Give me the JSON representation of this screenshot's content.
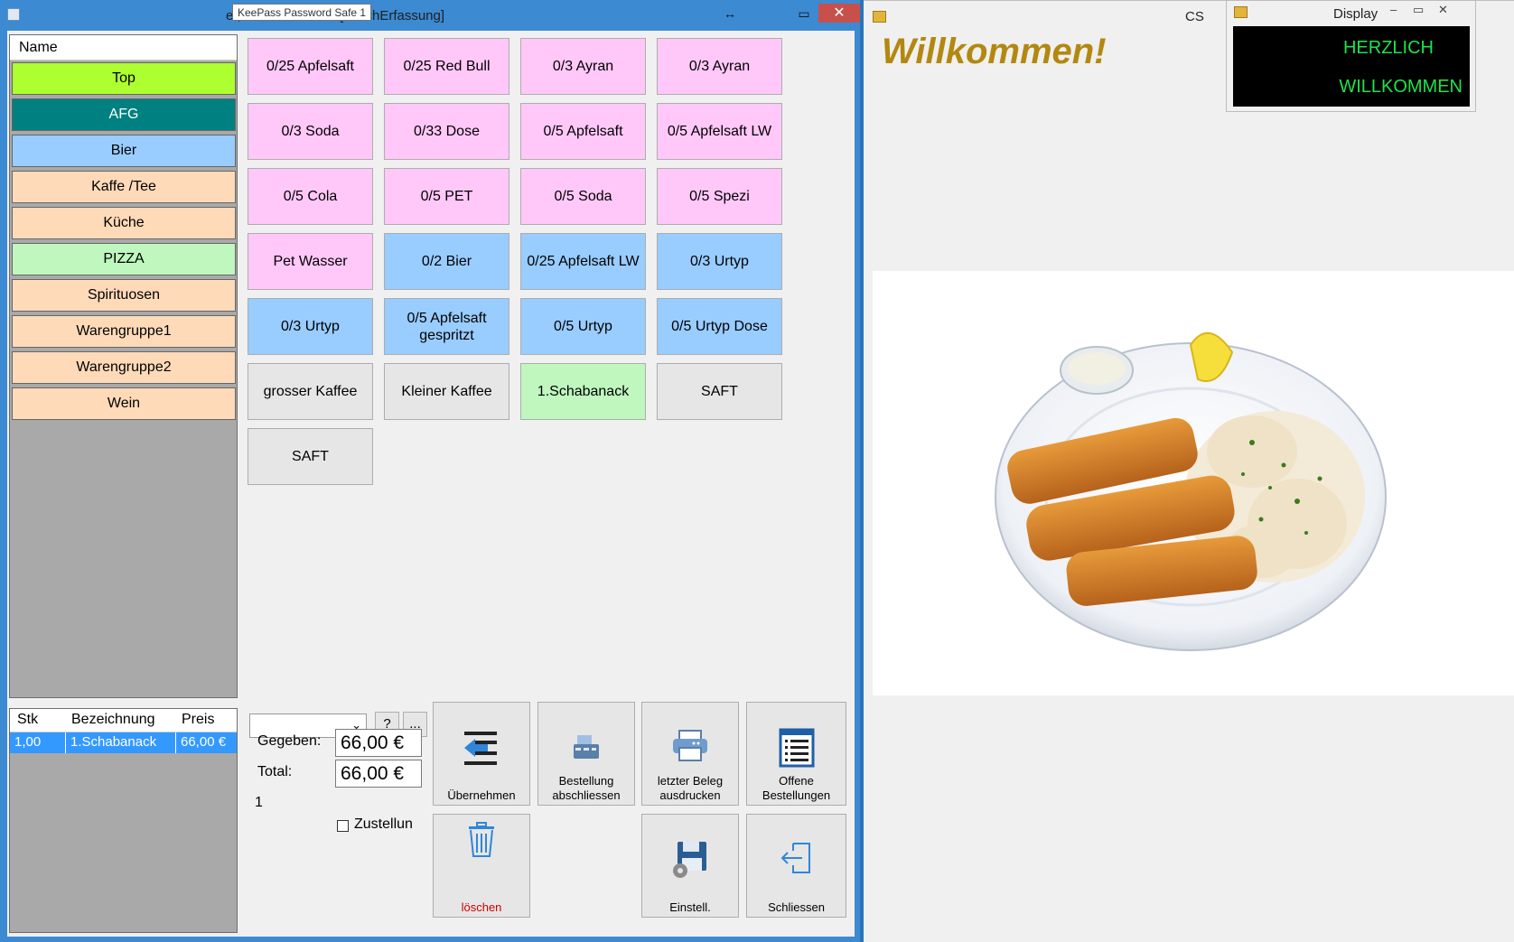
{
  "main_window": {
    "title": "et, GRITON.NET - [TouchErfassung]",
    "tooltip": "KeePass Password Safe 1",
    "close_glyph": "✕",
    "restore_glyph": "↔",
    "maximize_glyph": "▭"
  },
  "categories": {
    "header": "Name",
    "items": [
      {
        "label": "Top",
        "color": "#adff2f"
      },
      {
        "label": "AFG",
        "color": "#008080",
        "text_color": "#ffffff"
      },
      {
        "label": "Bier",
        "color": "#99ccff"
      },
      {
        "label": "Kaffe /Tee",
        "color": "#ffdab9"
      },
      {
        "label": "Küche",
        "color": "#ffdab9"
      },
      {
        "label": "PIZZA",
        "color": "#bff7bf"
      },
      {
        "label": "Spirituosen",
        "color": "#ffdab9"
      },
      {
        "label": "Warengruppe1",
        "color": "#ffdab9"
      },
      {
        "label": "Warengruppe2",
        "color": "#ffdab9"
      },
      {
        "label": "Wein",
        "color": "#ffdab9"
      }
    ]
  },
  "products": [
    {
      "label": "0/25 Apfelsaft",
      "color": "#ffc8f8"
    },
    {
      "label": "0/25 Red Bull",
      "color": "#ffc8f8"
    },
    {
      "label": "0/3 Ayran",
      "color": "#ffc8f8"
    },
    {
      "label": "0/3 Ayran",
      "color": "#ffc8f8"
    },
    {
      "label": "0/3 Soda",
      "color": "#ffc8f8"
    },
    {
      "label": "0/33  Dose",
      "color": "#ffc8f8"
    },
    {
      "label": "0/5 Apfelsaft",
      "color": "#ffc8f8"
    },
    {
      "label": "0/5 Apfelsaft LW",
      "color": "#ffc8f8"
    },
    {
      "label": "0/5 Cola",
      "color": "#ffc8f8"
    },
    {
      "label": "0/5 PET",
      "color": "#ffc8f8"
    },
    {
      "label": "0/5 Soda",
      "color": "#ffc8f8"
    },
    {
      "label": "0/5 Spezi",
      "color": "#ffc8f8"
    },
    {
      "label": "Pet  Wasser",
      "color": "#ffc8f8"
    },
    {
      "label": "0/2 Bier",
      "color": "#99ccff"
    },
    {
      "label": "0/25 Apfelsaft LW",
      "color": "#99ccff"
    },
    {
      "label": "0/3 Urtyp",
      "color": "#99ccff"
    },
    {
      "label": "0/3 Urtyp",
      "color": "#99ccff"
    },
    {
      "label": "0/5 Apfelsaft\ngespritzt",
      "color": "#99ccff"
    },
    {
      "label": "0/5 Urtyp",
      "color": "#99ccff"
    },
    {
      "label": "0/5 Urtyp Dose",
      "color": "#99ccff"
    },
    {
      "label": "grosser Kaffee",
      "color": "#e6e6e6"
    },
    {
      "label": "Kleiner Kaffee",
      "color": "#e6e6e6"
    },
    {
      "label": "1.Schabanack",
      "color": "#bff7bf"
    },
    {
      "label": "SAFT",
      "color": "#e6e6e6"
    },
    {
      "label": "SAFT",
      "color": "#e6e6e6"
    }
  ],
  "order": {
    "columns": [
      "Stk",
      "Bezeichnung",
      "Preis"
    ],
    "rows": [
      [
        "1,00",
        "1.Schabanack",
        "66,00 €"
      ]
    ]
  },
  "payment": {
    "help_button": "?",
    "more_button": "...",
    "given_label": "Gegeben:",
    "given_value": "66,00 €",
    "total_label": "Total:",
    "total_value": "66,00 €",
    "count": "1",
    "delivery_label": "Zustellun"
  },
  "actions": {
    "take_over": "Übernehmen",
    "close_order": "Bestellung\nabschliessen",
    "print_last": "letzter Beleg\nausdrucken",
    "open_orders": "Offene\nBestellungen",
    "delete": "löschen",
    "settings": "Einstell.",
    "exit": "Schliessen",
    "delete_color": "#cc0000"
  },
  "customer_display": {
    "title": "CS",
    "welcome": "Willkommen!"
  },
  "display_popup": {
    "title": "Display",
    "line1": "HERZLICH",
    "line2": "WILLKOMMEN",
    "led_color": "#1ee34b"
  }
}
